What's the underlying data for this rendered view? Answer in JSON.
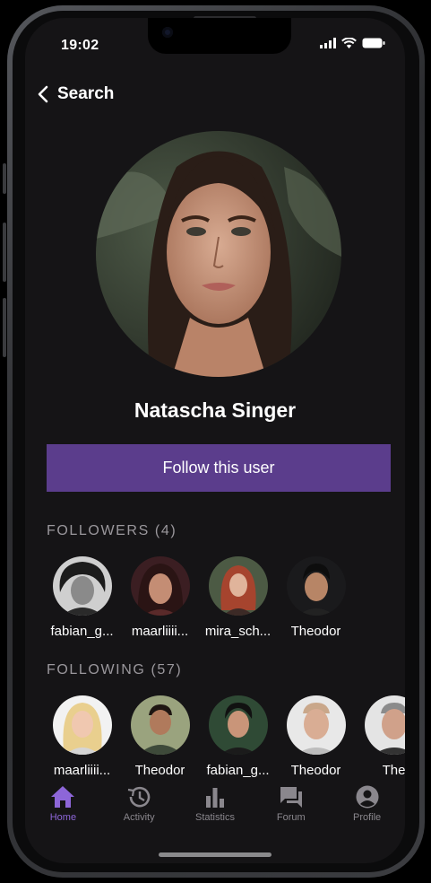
{
  "status": {
    "time": "19:02"
  },
  "nav": {
    "back_label": "Search"
  },
  "profile": {
    "name": "Natascha Singer",
    "follow_label": "Follow this user"
  },
  "followers": {
    "title": "FOLLOWERS (4)",
    "people": [
      {
        "name": "fabian_g..."
      },
      {
        "name": "maarliiii..."
      },
      {
        "name": "mira_sch..."
      },
      {
        "name": "Theodor"
      }
    ]
  },
  "following": {
    "title": "FOLLOWING (57)",
    "people": [
      {
        "name": "maarliiii..."
      },
      {
        "name": "Theodor"
      },
      {
        "name": "fabian_g..."
      },
      {
        "name": "Theodor"
      },
      {
        "name": "The"
      }
    ]
  },
  "tabbar": {
    "tabs": [
      {
        "label": "Home",
        "icon": "home-icon",
        "active": true
      },
      {
        "label": "Activity",
        "icon": "history-icon",
        "active": false
      },
      {
        "label": "Statistics",
        "icon": "bar-chart-icon",
        "active": false
      },
      {
        "label": "Forum",
        "icon": "forum-icon",
        "active": false
      },
      {
        "label": "Profile",
        "icon": "profile-icon",
        "active": false
      }
    ]
  },
  "colors": {
    "accent": "#5b3d8c",
    "active_tab": "#8d66d8",
    "background": "#151416"
  }
}
